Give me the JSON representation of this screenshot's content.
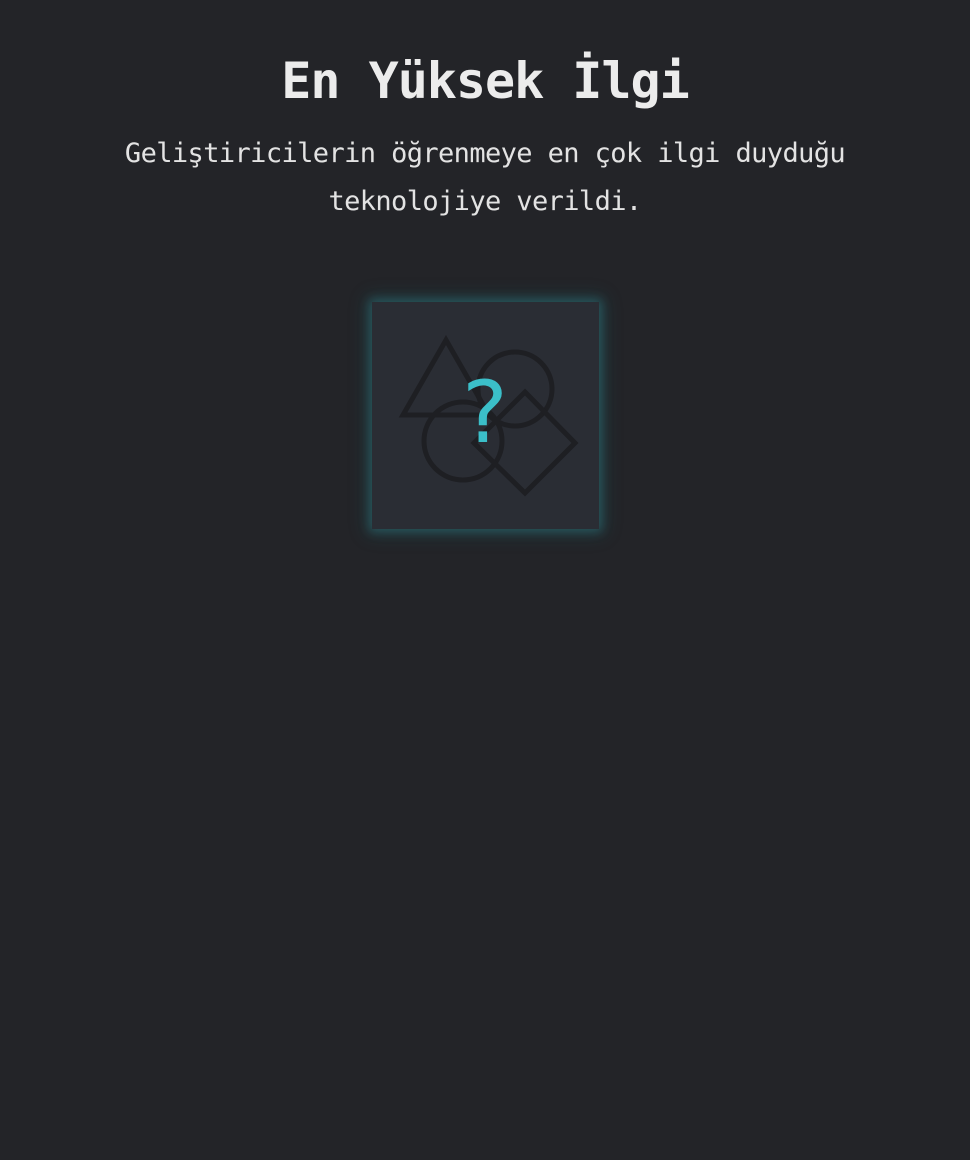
{
  "award": {
    "title": "En Yüksek İlgi",
    "description": "Geliştiricilerin öğrenmeye en çok ilgi duyduğu teknolojiye verildi."
  },
  "mystery_card": {
    "glyph": "?",
    "icon": "shapes-icon",
    "accent_color": "#3bbfc9",
    "shape_color": "#1d1e22"
  }
}
